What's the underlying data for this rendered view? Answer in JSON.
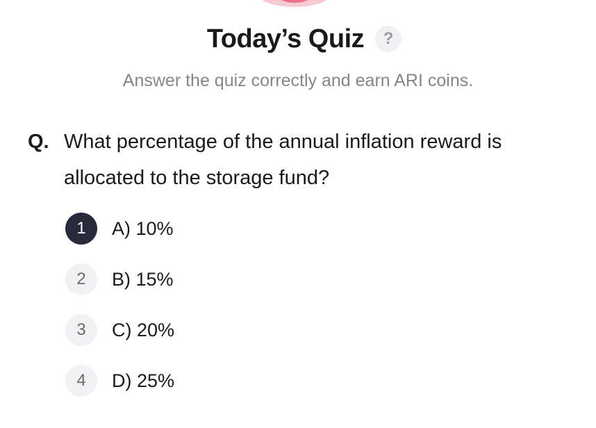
{
  "header": {
    "title": "Today’s Quiz",
    "help_icon": "?",
    "subtitle": "Answer the quiz correctly and earn ARI coins."
  },
  "question": {
    "prefix": "Q.",
    "text": "What percentage of the annual inflation reward is allocated to the storage fund?"
  },
  "options": [
    {
      "number": "1",
      "label": "A) 10%",
      "selected": true
    },
    {
      "number": "2",
      "label": "B) 15%",
      "selected": false
    },
    {
      "number": "3",
      "label": "C) 20%",
      "selected": false
    },
    {
      "number": "4",
      "label": "D) 25%",
      "selected": false
    }
  ],
  "colors": {
    "selected_badge": "#262a3b",
    "unselected_badge": "#f2f2f4",
    "subtitle": "#85858a",
    "decoration": "#ef6f8b"
  },
  "icons": {
    "help": "question-mark-icon",
    "decoration": "pink-mascot-icon"
  }
}
